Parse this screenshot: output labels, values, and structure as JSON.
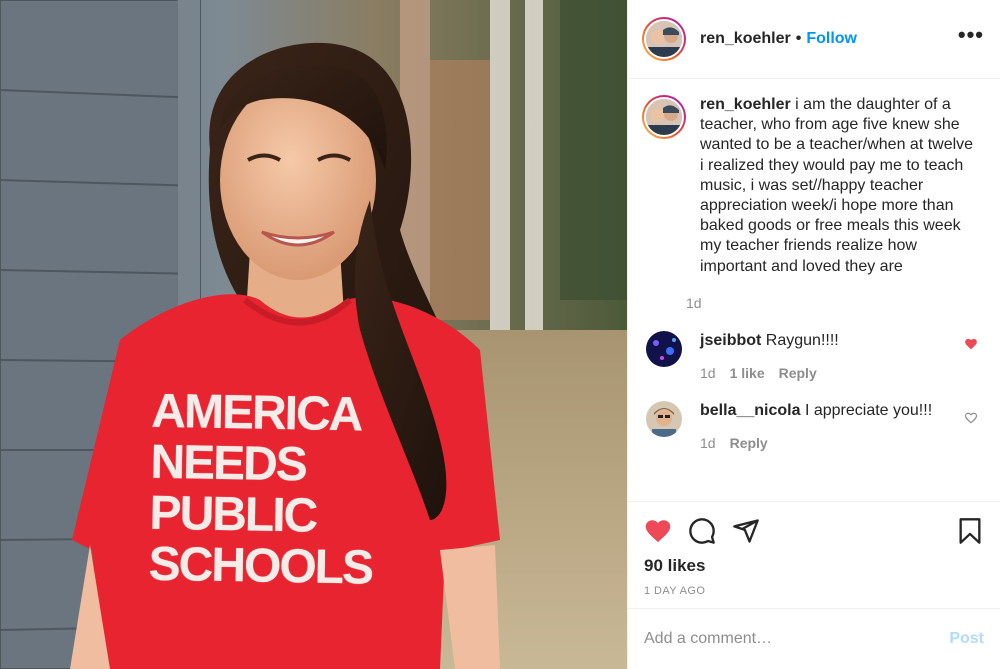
{
  "post": {
    "shirt_lines": [
      "AMERICA",
      "NEEDS",
      "PUBLIC",
      "SCHOOLS"
    ]
  },
  "header": {
    "username": "ren_koehler",
    "separator": "•",
    "follow_label": "Follow",
    "more_label": "•••"
  },
  "caption": {
    "username": "ren_koehler",
    "text": " i am the daughter of a teacher, who from age five knew she wanted to be a teacher/when at twelve i realized they would pay me to teach music, i was set//happy teacher appreciation week/i hope more than baked goods or free meals this week my teacher friends realize how important and loved they are",
    "age": "1d"
  },
  "comments": [
    {
      "username": "jseibbot",
      "text": " Raygun!!!!",
      "age": "1d",
      "likes": "1 like",
      "reply_label": "Reply",
      "liked": true
    },
    {
      "username": "bella__nicola",
      "text": " I appreciate you!!!",
      "age": "1d",
      "likes": "",
      "reply_label": "Reply",
      "liked": false
    }
  ],
  "actions": {
    "likes": "90 likes",
    "timestamp": "1 DAY AGO"
  },
  "add_comment": {
    "placeholder": "Add a comment…",
    "post_label": "Post"
  },
  "colors": {
    "accent": "#0095f6",
    "heart": "#ed4956",
    "muted": "#8e8e8e",
    "post_disabled": "#b3dbff"
  },
  "icons": [
    "more-icon",
    "heart-icon",
    "comment-icon",
    "share-icon",
    "bookmark-icon"
  ]
}
